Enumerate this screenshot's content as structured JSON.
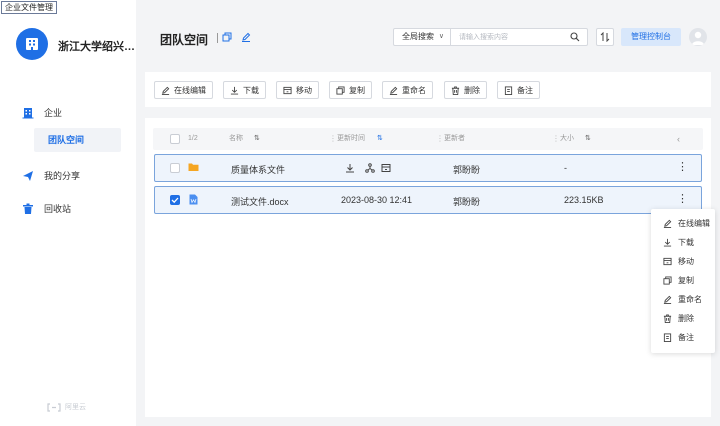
{
  "window_title": "企业文件管理",
  "sidebar": {
    "org_name": "浙江大学绍兴…",
    "items": [
      {
        "label": "企业"
      },
      {
        "label": "团队空间"
      },
      {
        "label": "我的分享"
      },
      {
        "label": "回收站"
      }
    ],
    "brand": "阿里云"
  },
  "header": {
    "title": "团队空间",
    "search_scope": "全局搜索",
    "search_placeholder": "请输入搜索内容",
    "admin_button": "管理控制台"
  },
  "toolbar": {
    "buttons": [
      "在线编辑",
      "下载",
      "移动",
      "复制",
      "重命名",
      "删除",
      "备注"
    ]
  },
  "table": {
    "selection_count": "1/2",
    "columns": [
      "名称",
      "更新时间",
      "更新者",
      "大小"
    ],
    "rows": [
      {
        "name": "质量体系文件",
        "type": "folder",
        "updated": "",
        "updater": "郭盼盼",
        "size": "-",
        "checked": false
      },
      {
        "name": "测试文件.docx",
        "type": "doc",
        "updated": "2023-08-30 12:41",
        "updater": "郭盼盼",
        "size": "223.15KB",
        "checked": true
      }
    ]
  },
  "context_menu": {
    "items": [
      "在线编辑",
      "下载",
      "移动",
      "复制",
      "重命名",
      "删除",
      "备注"
    ]
  },
  "colors": {
    "accent": "#1f6fe5",
    "row_selected_bg": "#eef4fc",
    "row_border": "#7aa4dc",
    "folder": "#f5a623"
  }
}
